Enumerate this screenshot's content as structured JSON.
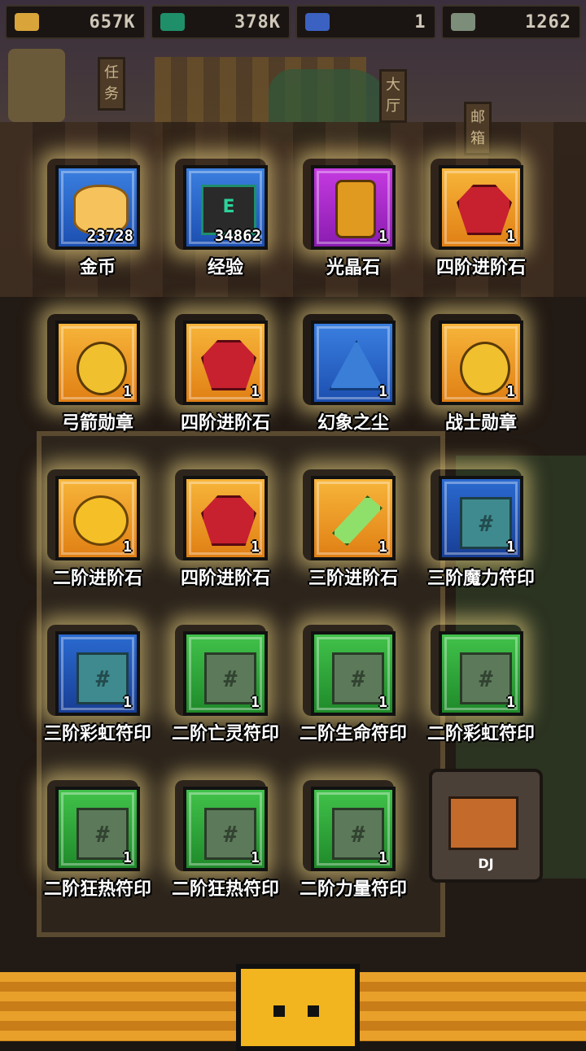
{
  "topbar": {
    "resources": [
      {
        "icon": "gold-coin-icon",
        "value": "657K"
      },
      {
        "icon": "exp-icon",
        "value": "378K"
      },
      {
        "icon": "blue-gem-icon",
        "value": "1"
      },
      {
        "icon": "cross-icon",
        "value": "1262"
      }
    ]
  },
  "background": {
    "signs": [
      "任务",
      "大厅",
      "邮箱"
    ]
  },
  "rewards": [
    {
      "name": "金币",
      "qty": "23728",
      "frame": "blue",
      "icon": "coin"
    },
    {
      "name": "经验",
      "qty": "34862",
      "frame": "blue",
      "icon": "exp"
    },
    {
      "name": "光晶石",
      "qty": "1",
      "frame": "purple",
      "icon": "crystal"
    },
    {
      "name": "四阶进阶石",
      "qty": "1",
      "frame": "gold",
      "icon": "ruby"
    },
    {
      "name": "弓箭勋章",
      "qty": "1",
      "frame": "gold",
      "icon": "medal"
    },
    {
      "name": "四阶进阶石",
      "qty": "1",
      "frame": "gold",
      "icon": "ruby"
    },
    {
      "name": "幻象之尘",
      "qty": "1",
      "frame": "blue",
      "icon": "dust"
    },
    {
      "name": "战士勋章",
      "qty": "1",
      "frame": "gold",
      "icon": "medal"
    },
    {
      "name": "二阶进阶石",
      "qty": "1",
      "frame": "gold",
      "icon": "egg"
    },
    {
      "name": "四阶进阶石",
      "qty": "1",
      "frame": "gold",
      "icon": "ruby"
    },
    {
      "name": "三阶进阶石",
      "qty": "1",
      "frame": "gold",
      "icon": "shard"
    },
    {
      "name": "三阶魔力符印",
      "qty": "1",
      "frame": "navy",
      "icon": "rune-teal"
    },
    {
      "name": "三阶彩虹符印",
      "qty": "1",
      "frame": "navy",
      "icon": "rune-teal"
    },
    {
      "name": "二阶亡灵符印",
      "qty": "1",
      "frame": "green",
      "icon": "rune"
    },
    {
      "name": "二阶生命符印",
      "qty": "1",
      "frame": "green",
      "icon": "rune"
    },
    {
      "name": "二阶彩虹符印",
      "qty": "1",
      "frame": "green",
      "icon": "rune"
    },
    {
      "name": "二阶狂热符印",
      "qty": "1",
      "frame": "green",
      "icon": "rune"
    },
    {
      "name": "二阶狂热符印",
      "qty": "1",
      "frame": "green",
      "icon": "rune"
    },
    {
      "name": "二阶力量符印",
      "qty": "1",
      "frame": "green",
      "icon": "rune"
    }
  ],
  "dj_card": {
    "label": "DJ"
  }
}
